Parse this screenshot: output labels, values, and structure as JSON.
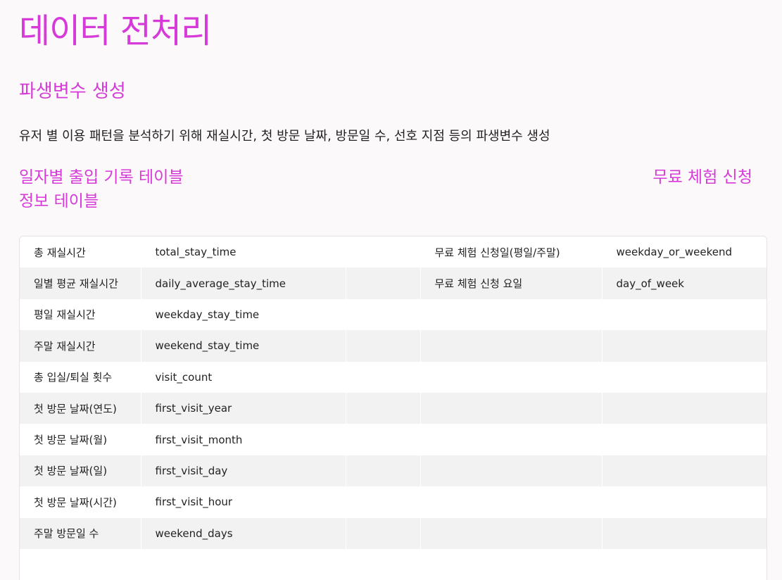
{
  "page": {
    "title": "데이터 전처리"
  },
  "section": {
    "title": "파생변수 생성",
    "description": "유저 별 이용 패턴을 분석하기 위해 재실시간, 첫 방문 날짜, 방문일 수, 선호 지점 등의 파생변수 생성"
  },
  "tables": {
    "left_title_line1": "일자별 출입 기록 테이블",
    "left_title_line2": "정보 테이블",
    "right_title": "무료 체험 신청"
  },
  "rows": [
    {
      "left_label": "총 재실시간",
      "left_var": "total_stay_time",
      "right_label": "무료 체험 신청일(평일/주말)",
      "right_var": "weekday_or_weekend"
    },
    {
      "left_label": "일별 평균 재실시간",
      "left_var": "daily_average_stay_time",
      "right_label": "무료 체험 신청 요일",
      "right_var": "day_of_week"
    },
    {
      "left_label": "평일 재실시간",
      "left_var": "weekday_stay_time",
      "right_label": "",
      "right_var": ""
    },
    {
      "left_label": "주말 재실시간",
      "left_var": "weekend_stay_time",
      "right_label": "",
      "right_var": ""
    },
    {
      "left_label": "총 입실/퇴실 횟수",
      "left_var": "visit_count",
      "right_label": "",
      "right_var": ""
    },
    {
      "left_label": "첫 방문 날짜(연도)",
      "left_var": "first_visit_year",
      "right_label": "",
      "right_var": ""
    },
    {
      "left_label": "첫 방문 날짜(월)",
      "left_var": "first_visit_month",
      "right_label": "",
      "right_var": ""
    },
    {
      "left_label": "첫 방문 날짜(일)",
      "left_var": "first_visit_day",
      "right_label": "",
      "right_var": ""
    },
    {
      "left_label": "첫 방문 날짜(시간)",
      "left_var": "first_visit_hour",
      "right_label": "",
      "right_var": ""
    },
    {
      "left_label": "주말 방문일 수",
      "left_var": "weekend_days",
      "right_label": "",
      "right_var": ""
    }
  ]
}
